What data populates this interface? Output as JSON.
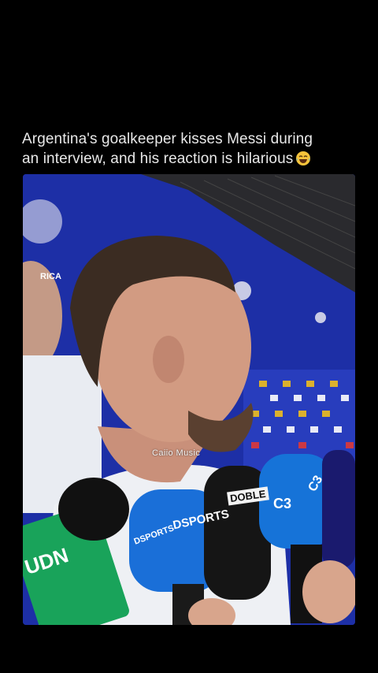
{
  "post": {
    "caption_line1": "Argentina's goalkeeper kisses Messi during",
    "caption_line2": "an interview, and his reaction is hilarious",
    "caption_emoji": "laughing-crying-face-icon"
  },
  "video": {
    "watermark": "Caiio Music",
    "mic_labels": {
      "dsports_a": "DSPORTS",
      "dsports_b": "DSPORTS",
      "doble": "DOBLE",
      "c3": "C3",
      "c3b": "C3",
      "tudn": "UDN",
      "backdrop": "RICA"
    }
  },
  "colors": {
    "background": "#000000",
    "backdrop_blue": "#1d2fa6",
    "tudn_green": "#19a35a"
  }
}
